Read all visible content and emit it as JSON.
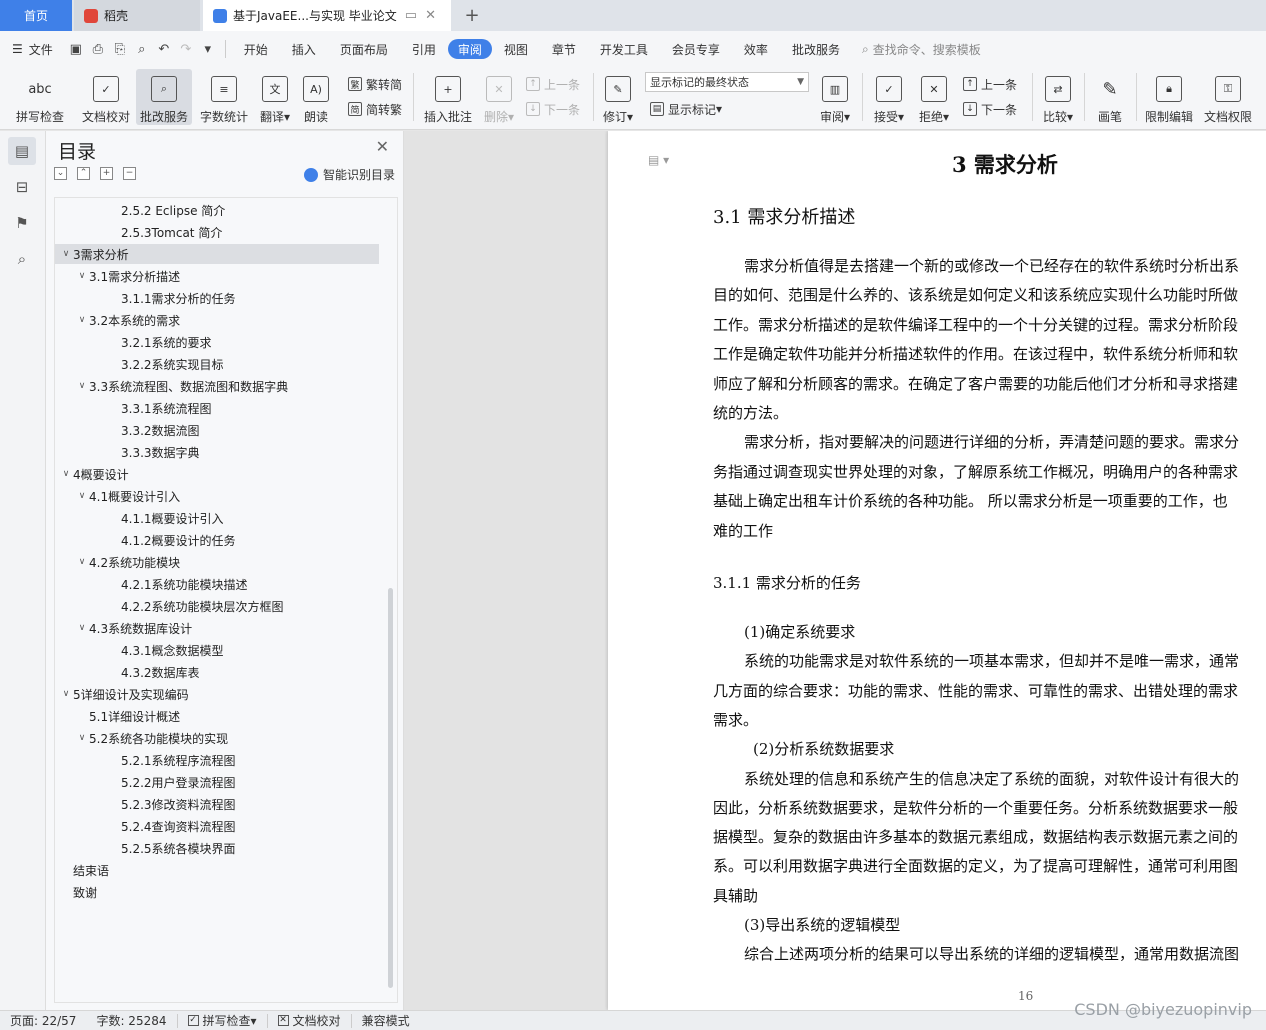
{
  "tabs": {
    "home": "首页",
    "daoke": "稻壳",
    "doc": "基于JavaEE...与实现 毕业论文",
    "add": "+"
  },
  "menu": {
    "file": "文件",
    "items": [
      "开始",
      "插入",
      "页面布局",
      "引用",
      "审阅",
      "视图",
      "章节",
      "开发工具",
      "会员专享",
      "效率",
      "批改服务"
    ],
    "active_index": 4,
    "search": "查找命令、搜索模板"
  },
  "ribbon": {
    "spell_check": "拼写检查",
    "doc_check": "文档校对",
    "correction": "批改服务",
    "word_count": "字数统计",
    "translate": "翻译",
    "read_aloud": "朗读",
    "to_traditional": "繁转简",
    "to_simplified": "简转繁",
    "insert_comment": "插入批注",
    "delete": "删除",
    "prev1": "上一条",
    "next1": "下一条",
    "track": "修订",
    "markup_state": "显示标记的最终状态",
    "show_markup": "显示标记",
    "review": "审阅",
    "accept": "接受",
    "reject": "拒绝",
    "prev2": "上一条",
    "next2": "下一条",
    "compare": "比较",
    "pen": "画笔",
    "restrict_edit": "限制编辑",
    "doc_permission": "文档权限",
    "abc": "abc"
  },
  "toc": {
    "title": "目录",
    "smart": "智能识别目录",
    "items": [
      {
        "label": "2.5.2  Eclipse 简介",
        "level": 3,
        "arrow": ""
      },
      {
        "label": "2.5.3Tomcat 简介",
        "level": 3,
        "arrow": ""
      },
      {
        "label": "3需求分析",
        "level": 1,
        "arrow": "v",
        "selected": true
      },
      {
        "label": "3.1需求分析描述",
        "level": 2,
        "arrow": "v"
      },
      {
        "label": "3.1.1需求分析的任务",
        "level": 3,
        "arrow": ""
      },
      {
        "label": "3.2本系统的需求",
        "level": 2,
        "arrow": "v"
      },
      {
        "label": "3.2.1系统的要求",
        "level": 3,
        "arrow": ""
      },
      {
        "label": "3.2.2系统实现目标",
        "level": 3,
        "arrow": ""
      },
      {
        "label": "3.3系统流程图、数据流图和数据字典",
        "level": 2,
        "arrow": "v"
      },
      {
        "label": "3.3.1系统流程图",
        "level": 3,
        "arrow": ""
      },
      {
        "label": "3.3.2数据流图",
        "level": 3,
        "arrow": ""
      },
      {
        "label": "3.3.3数据字典",
        "level": 3,
        "arrow": ""
      },
      {
        "label": "4概要设计",
        "level": 1,
        "arrow": "v"
      },
      {
        "label": "4.1概要设计引入",
        "level": 2,
        "arrow": "v"
      },
      {
        "label": "4.1.1概要设计引入",
        "level": 3,
        "arrow": ""
      },
      {
        "label": "4.1.2概要设计的任务",
        "level": 3,
        "arrow": ""
      },
      {
        "label": "4.2系统功能模块",
        "level": 2,
        "arrow": "v"
      },
      {
        "label": "4.2.1系统功能模块描述",
        "level": 3,
        "arrow": ""
      },
      {
        "label": "4.2.2系统功能模块层次方框图",
        "level": 3,
        "arrow": ""
      },
      {
        "label": "4.3系统数据库设计",
        "level": 2,
        "arrow": "v"
      },
      {
        "label": "4.3.1概念数据模型",
        "level": 3,
        "arrow": ""
      },
      {
        "label": "4.3.2数据库表",
        "level": 3,
        "arrow": ""
      },
      {
        "label": "5详细设计及实现编码",
        "level": 1,
        "arrow": "v"
      },
      {
        "label": "5.1详细设计概述",
        "level": 2,
        "arrow": ""
      },
      {
        "label": "5.2系统各功能模块的实现",
        "level": 2,
        "arrow": "v"
      },
      {
        "label": "5.2.1系统程序流程图",
        "level": 3,
        "arrow": ""
      },
      {
        "label": "5.2.2用户登录流程图",
        "level": 3,
        "arrow": ""
      },
      {
        "label": "5.2.3修改资料流程图",
        "level": 3,
        "arrow": ""
      },
      {
        "label": "5.2.4查询资料流程图",
        "level": 3,
        "arrow": ""
      },
      {
        "label": "5.2.5系统各模块界面",
        "level": 3,
        "arrow": ""
      },
      {
        "label": "结束语",
        "level": 1,
        "arrow": ""
      },
      {
        "label": "致谢",
        "level": 1,
        "arrow": ""
      }
    ]
  },
  "document": {
    "chapter_title": "3  需求分析",
    "section_title": "3.1  需求分析描述",
    "subsection_title": "3.1.1  需求分析的任务",
    "page_number": "16",
    "lines": [
      {
        "text": "需求分析值得是去搭建一个新的或修改一个已经存在的软件系统时分析出系",
        "indent": true
      },
      {
        "text": "目的如何、范围是什么养的、该系统是如何定义和该系统应实现什么功能时所做",
        "indent": false
      },
      {
        "text": "工作。需求分析描述的是软件编译工程中的一个十分关键的过程。需求分析阶段",
        "indent": false
      },
      {
        "text": "工作是确定软件功能并分析描述软件的作用。在该过程中，软件系统分析师和软",
        "indent": false
      },
      {
        "text": "师应了解和分析顾客的需求。在确定了客户需要的功能后他们才分析和寻求搭建",
        "indent": false
      },
      {
        "text": "统的方法。",
        "indent": false
      },
      {
        "text": "需求分析，指对要解决的问题进行详细的分析，弄清楚问题的要求。需求分",
        "indent": true
      },
      {
        "text": "务指通过调查现实世界处理的对象，了解原系统工作概况，明确用户的各种需求",
        "indent": false
      },
      {
        "text": "基础上确定出租车计价系统的各种功能。  所以需求分析是一项重要的工作，也",
        "indent": false
      },
      {
        "text": "难的工作",
        "indent": false
      }
    ],
    "lines2": [
      {
        "text": "(1)确定系统要求",
        "indent": true
      },
      {
        "text": "系统的功能需求是对软件系统的一项基本需求，但却并不是唯一需求，通常",
        "indent": true
      },
      {
        "text": "几方面的综合要求：功能的需求、性能的需求、可靠性的需求、出错处理的需求",
        "indent": false
      },
      {
        "text": "需求。",
        "indent": false
      },
      {
        "text": "(2)分析系统数据要求",
        "indent": "2"
      },
      {
        "text": "系统处理的信息和系统产生的信息决定了系统的面貌，对软件设计有很大的",
        "indent": true
      },
      {
        "text": "因此，分析系统数据要求，是软件分析的一个重要任务。分析系统数据要求一般",
        "indent": false
      },
      {
        "text": "据模型。复杂的数据由许多基本的数据元素组成，数据结构表示数据元素之间的",
        "indent": false
      },
      {
        "text": "系。可以利用数据字典进行全面数据的定义，为了提高可理解性，通常可利用图",
        "indent": false
      },
      {
        "text": "具辅助",
        "indent": false
      },
      {
        "text": "(3)导出系统的逻辑模型",
        "indent": true
      },
      {
        "text": "综合上述两项分析的结果可以导出系统的详细的逻辑模型，通常用数据流图",
        "indent": true
      }
    ]
  },
  "status": {
    "page": "页面: 22/57",
    "words": "字数: 25284",
    "spell": "拼写检查",
    "proof": "文档校对",
    "compat": "兼容模式"
  },
  "watermark": "CSDN @biyezuopinvip",
  "colors": {
    "accent": "#3f80e8"
  }
}
